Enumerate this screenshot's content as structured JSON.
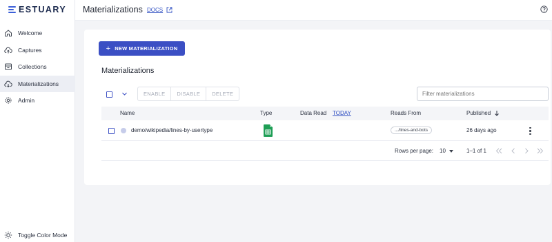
{
  "brand": {
    "name": "ESTUARY",
    "color": "#3b5fd8"
  },
  "header": {
    "title": "Materializations",
    "docs_label": "DOCS",
    "docs_icon": "external-link-icon",
    "help_icon": "help-circle-icon"
  },
  "sidebar": {
    "items": [
      {
        "label": "Welcome",
        "icon": "home-icon",
        "active": false
      },
      {
        "label": "Captures",
        "icon": "cloud-upload-icon",
        "active": false
      },
      {
        "label": "Collections",
        "icon": "collections-icon",
        "active": false
      },
      {
        "label": "Materializations",
        "icon": "cloud-download-icon",
        "active": true
      },
      {
        "label": "Admin",
        "icon": "gear-icon",
        "active": false
      }
    ],
    "toggle_label": "Toggle Color Mode",
    "toggle_icon": "sun-icon"
  },
  "main": {
    "new_button": "NEW MATERIALIZATION",
    "section_title": "Materializations",
    "actions": {
      "enable": "ENABLE",
      "disable": "DISABLE",
      "delete": "DELETE"
    },
    "filter_placeholder": "Filter materializations",
    "columns": {
      "name": "Name",
      "type": "Type",
      "data_read": "Data Read",
      "today": "TODAY",
      "reads_from": "Reads From",
      "published": "Published"
    },
    "rows": [
      {
        "name": "demo/wikipedia/lines-by-usertype",
        "type_icon": "google-sheets-icon",
        "reads_from": ".../lines-and-bots",
        "published": "26 days ago"
      }
    ],
    "pagination": {
      "rows_per_page_label": "Rows per page:",
      "rows_per_page": "10",
      "range": "1–1 of 1"
    }
  },
  "colors": {
    "accent": "#3b4fc4",
    "link": "#2f4fc2",
    "sheets_green": "#1e9e55"
  }
}
